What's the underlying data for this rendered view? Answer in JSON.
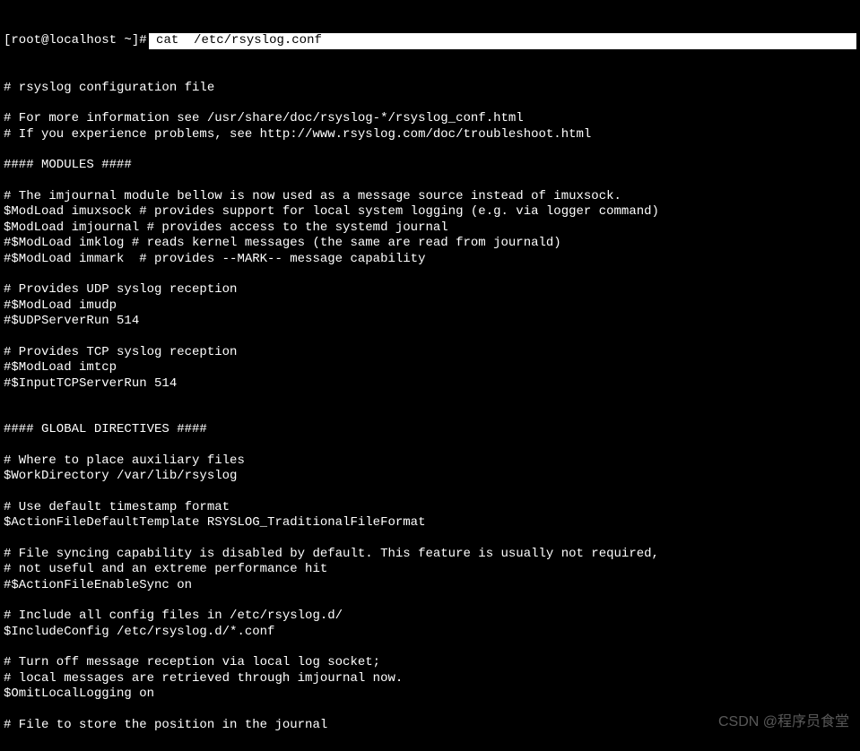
{
  "prompt": "[root@localhost ~]#",
  "command": " cat  /etc/rsyslog.conf",
  "lines": [
    "# rsyslog configuration file",
    "",
    "# For more information see /usr/share/doc/rsyslog-*/rsyslog_conf.html",
    "# If you experience problems, see http://www.rsyslog.com/doc/troubleshoot.html",
    "",
    "#### MODULES ####",
    "",
    "# The imjournal module bellow is now used as a message source instead of imuxsock.",
    "$ModLoad imuxsock # provides support for local system logging (e.g. via logger command)",
    "$ModLoad imjournal # provides access to the systemd journal",
    "#$ModLoad imklog # reads kernel messages (the same are read from journald)",
    "#$ModLoad immark  # provides --MARK-- message capability",
    "",
    "# Provides UDP syslog reception",
    "#$ModLoad imudp",
    "#$UDPServerRun 514",
    "",
    "# Provides TCP syslog reception",
    "#$ModLoad imtcp",
    "#$InputTCPServerRun 514",
    "",
    "",
    "#### GLOBAL DIRECTIVES ####",
    "",
    "# Where to place auxiliary files",
    "$WorkDirectory /var/lib/rsyslog",
    "",
    "# Use default timestamp format",
    "$ActionFileDefaultTemplate RSYSLOG_TraditionalFileFormat",
    "",
    "# File syncing capability is disabled by default. This feature is usually not required,",
    "# not useful and an extreme performance hit",
    "#$ActionFileEnableSync on",
    "",
    "# Include all config files in /etc/rsyslog.d/",
    "$IncludeConfig /etc/rsyslog.d/*.conf",
    "",
    "# Turn off message reception via local log socket;",
    "# local messages are retrieved through imjournal now.",
    "$OmitLocalLogging on",
    "",
    "# File to store the position in the journal"
  ],
  "watermark": "CSDN @程序员食堂"
}
